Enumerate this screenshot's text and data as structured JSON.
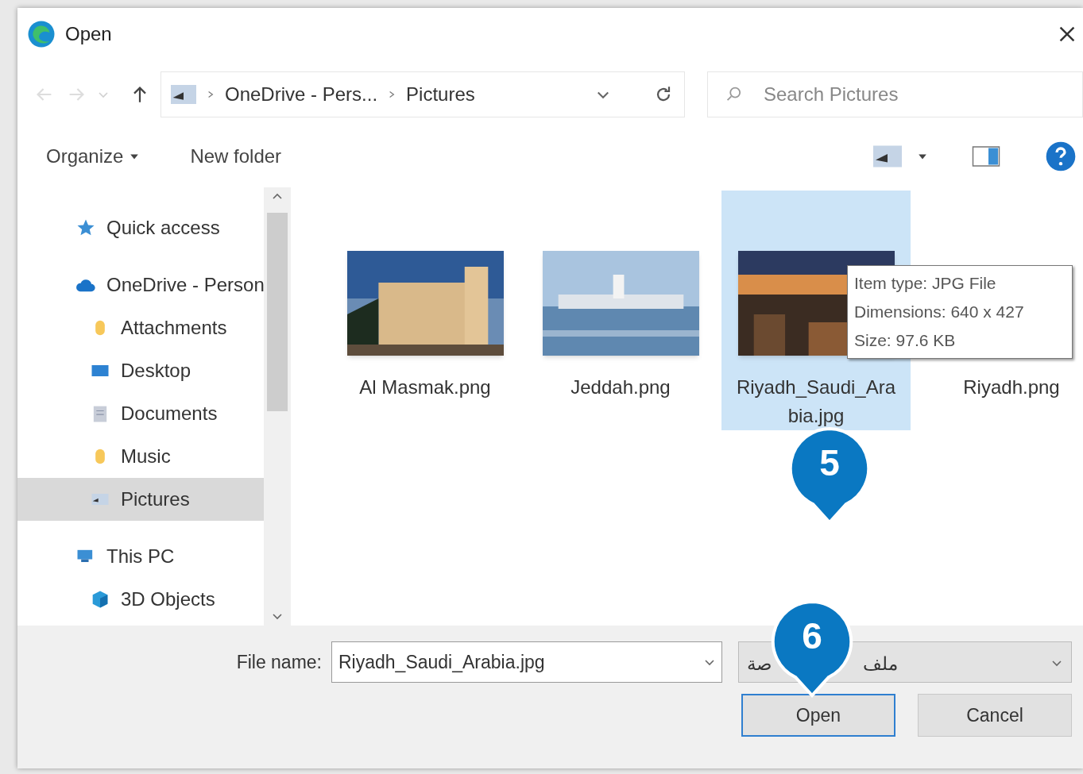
{
  "window": {
    "title": "Open"
  },
  "address": {
    "path": [
      {
        "label": "OneDrive - Pers..."
      },
      {
        "label": "Pictures"
      }
    ]
  },
  "search": {
    "placeholder": "Search Pictures"
  },
  "toolbar": {
    "buttons": [
      {
        "label": "Organize",
        "dropdown": true
      },
      {
        "label": "New folder",
        "dropdown": false
      }
    ]
  },
  "nav": [
    {
      "label": "Quick access",
      "selected": false
    },
    {
      "label": "OneDrive - Person",
      "selected": false,
      "children": [
        {
          "label": "Attachments",
          "selected": false
        },
        {
          "label": "Desktop",
          "selected": false
        },
        {
          "label": "Documents",
          "selected": false
        },
        {
          "label": "Music",
          "selected": false
        },
        {
          "label": "Pictures",
          "selected": true
        }
      ]
    },
    {
      "label": "This PC",
      "selected": false,
      "children": [
        {
          "label": "3D Objects",
          "selected": false
        }
      ]
    }
  ],
  "files": [
    {
      "name": "Al Masmak.png",
      "selected": false,
      "kind": "picture"
    },
    {
      "name": "Jeddah.png",
      "selected": false,
      "kind": "picture"
    },
    {
      "name": "Riyadh_Saudi_Arabia.jpg",
      "selected": true,
      "kind": "picture"
    },
    {
      "name": "Riyadh.png",
      "selected": false
    }
  ],
  "tooltip": {
    "lines": [
      "Item type: JPG File",
      "Dimensions: 640 x 427",
      "Size: 97.6 KB"
    ]
  },
  "file_name": {
    "label": "File name:",
    "value": "Riyadh_Saudi_Arabia.jpg"
  },
  "file_type": {
    "parts": [
      "ملف",
      "صة"
    ]
  },
  "buttons": [
    {
      "label": "Open",
      "default": true
    },
    {
      "label": "Cancel",
      "default": false
    }
  ],
  "callouts": [
    {
      "label": "5"
    },
    {
      "label": "6"
    }
  ]
}
